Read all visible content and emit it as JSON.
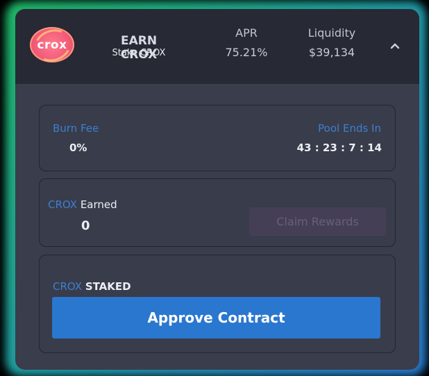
{
  "pool": {
    "logo_text": "crox",
    "title": "EARN CROX",
    "subtitle": "Stake CROX",
    "apr_label": "APR",
    "apr_value": "75.21%",
    "liquidity_label": "Liquidity",
    "liquidity_value": "$39,134",
    "collapse_icon": "chevron-up-icon"
  },
  "fees": {
    "burn_fee_label": "Burn Fee",
    "burn_fee_value": "0%",
    "pool_ends_label": "Pool Ends In",
    "pool_ends_value": "43 : 23 : 7 : 14"
  },
  "earned": {
    "token": "CROX",
    "label": "Earned",
    "value": "0",
    "claim_button": "Claim Rewards"
  },
  "staked": {
    "token": "CROX",
    "label": "STAKED",
    "approve_button": "Approve Contract"
  },
  "colors": {
    "accent_blue": "#3d7fd0",
    "button_blue": "#2a77cf",
    "logo_pink": "#f25a78"
  }
}
